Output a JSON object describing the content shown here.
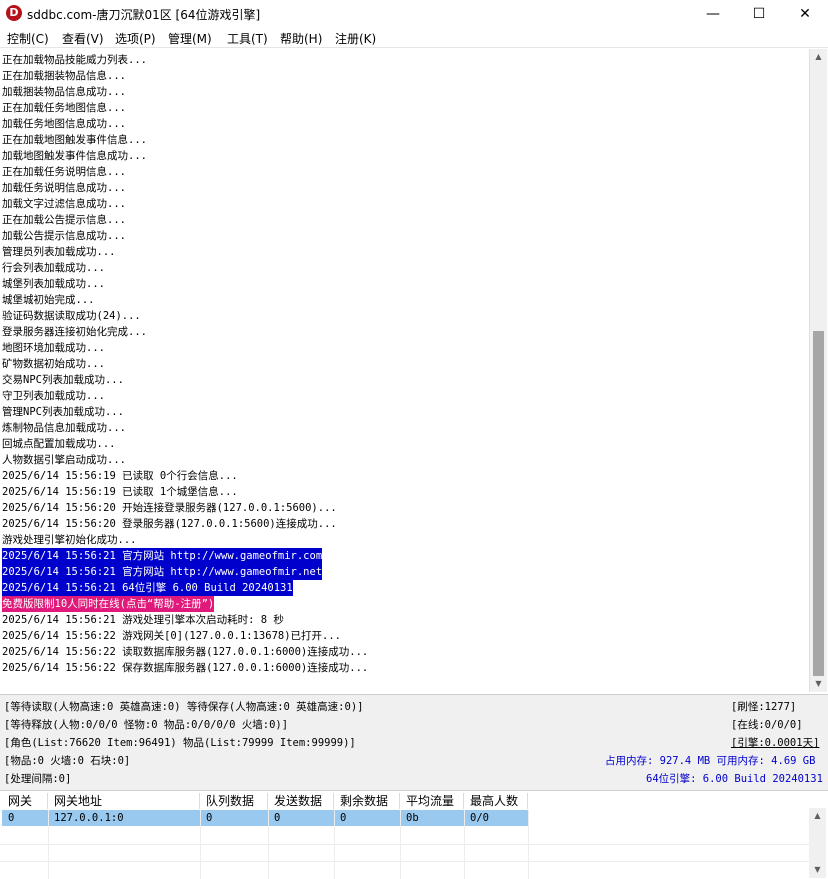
{
  "window": {
    "title": "sddbc.com-唐刀沉默01区 [64位游戏引擎]",
    "app_icon_letter": "D",
    "min_glyph": "—",
    "max_glyph": "☐",
    "close_glyph": "✕"
  },
  "menu": [
    "控制(C)",
    "查看(V)",
    "选项(P)",
    "管理(M)",
    "工具(T)",
    "帮助(H)",
    "注册(K)"
  ],
  "log": [
    {
      "text": "正在加载物品技能威力列表..."
    },
    {
      "text": "正在加载捆装物品信息..."
    },
    {
      "text": "加载捆装物品信息成功..."
    },
    {
      "text": "正在加载任务地图信息..."
    },
    {
      "text": "加载任务地图信息成功..."
    },
    {
      "text": "正在加载地图触发事件信息..."
    },
    {
      "text": "加载地图触发事件信息成功..."
    },
    {
      "text": "正在加载任务说明信息..."
    },
    {
      "text": "加载任务说明信息成功..."
    },
    {
      "text": "加载文字过滤信息成功..."
    },
    {
      "text": "正在加载公告提示信息..."
    },
    {
      "text": "加载公告提示信息成功..."
    },
    {
      "text": "管理员列表加载成功..."
    },
    {
      "text": "行会列表加载成功..."
    },
    {
      "text": "城堡列表加载成功..."
    },
    {
      "text": "城堡城初始完成..."
    },
    {
      "text": "验证码数据读取成功(24)..."
    },
    {
      "text": "登录服务器连接初始化完成..."
    },
    {
      "text": "地图环境加载成功..."
    },
    {
      "text": "矿物数据初始成功..."
    },
    {
      "text": "交易NPC列表加载成功..."
    },
    {
      "text": "守卫列表加载成功..."
    },
    {
      "text": "管理NPC列表加载成功..."
    },
    {
      "text": "炼制物品信息加载成功..."
    },
    {
      "text": "回城点配置加载成功..."
    },
    {
      "text": "人物数据引擎启动成功..."
    },
    {
      "text": "2025/6/14 15:56:19 已读取 0个行会信息..."
    },
    {
      "text": "2025/6/14 15:56:19 已读取 1个城堡信息..."
    },
    {
      "text": "2025/6/14 15:56:20 开始连接登录服务器(127.0.0.1:5600)..."
    },
    {
      "text": "2025/6/14 15:56:20 登录服务器(127.0.0.1:5600)连接成功..."
    },
    {
      "text": "游戏处理引擎初始化成功..."
    },
    {
      "text": "2025/6/14 15:56:21 官方网站 http://www.gameofmir.com",
      "hl": "blue"
    },
    {
      "text": "2025/6/14 15:56:21 官方网站 http://www.gameofmir.net",
      "hl": "blue"
    },
    {
      "text": "2025/6/14 15:56:21 64位引擎 6.00 Build 20240131",
      "hl": "blue"
    },
    {
      "text": "免费版限制10人同时在线(点击“帮助-注册”)",
      "hl": "pink"
    },
    {
      "text": "2025/6/14 15:56:21 游戏处理引擎本次启动耗时: 8 秒"
    },
    {
      "text": "2025/6/14 15:56:22 游戏网关[0](127.0.0.1:13678)已打开..."
    },
    {
      "text": "2025/6/14 15:56:22 读取数据库服务器(127.0.0.1:6000)连接成功..."
    },
    {
      "text": "2025/6/14 15:56:22 保存数据库服务器(127.0.0.1:6000)连接成功..."
    }
  ],
  "status": {
    "line1": "[等待读取(人物高速:0 英雄高速:0) 等待保存(人物高速:0 英雄高速:0)]",
    "line2": "[等待释放(人物:0/0/0 怪物:0 物品:0/0/0/0 火墙:0)]",
    "line3": "[角色(List:76620 Item:96491) 物品(List:79999 Item:99999)]",
    "line4": "[物品:0 火墙:0 石块:0]",
    "line5": "[处理间隔:0]",
    "refresh": "[刷怪:1277]",
    "online": "[在线:0/0/0]",
    "engine": "[引擎:0.0001天]",
    "memory": "占用内存: 927.4 MB 可用内存: 4.69 GB",
    "version": "64位引擎: 6.00 Build 20240131",
    "accent_color": "#0000cc"
  },
  "gateway_table": {
    "headers": [
      "网关",
      "网关地址",
      "队列数据",
      "发送数据",
      "剩余数据",
      "平均流量",
      "最高人数"
    ],
    "rows": [
      [
        "0",
        "127.0.0.1:0",
        "0",
        "0",
        "0",
        "0b",
        "0/0"
      ]
    ]
  },
  "colors": {
    "highlight_blue": "#0000cc",
    "highlight_pink": "#e0197a",
    "selected_row": "#99c9ef"
  }
}
